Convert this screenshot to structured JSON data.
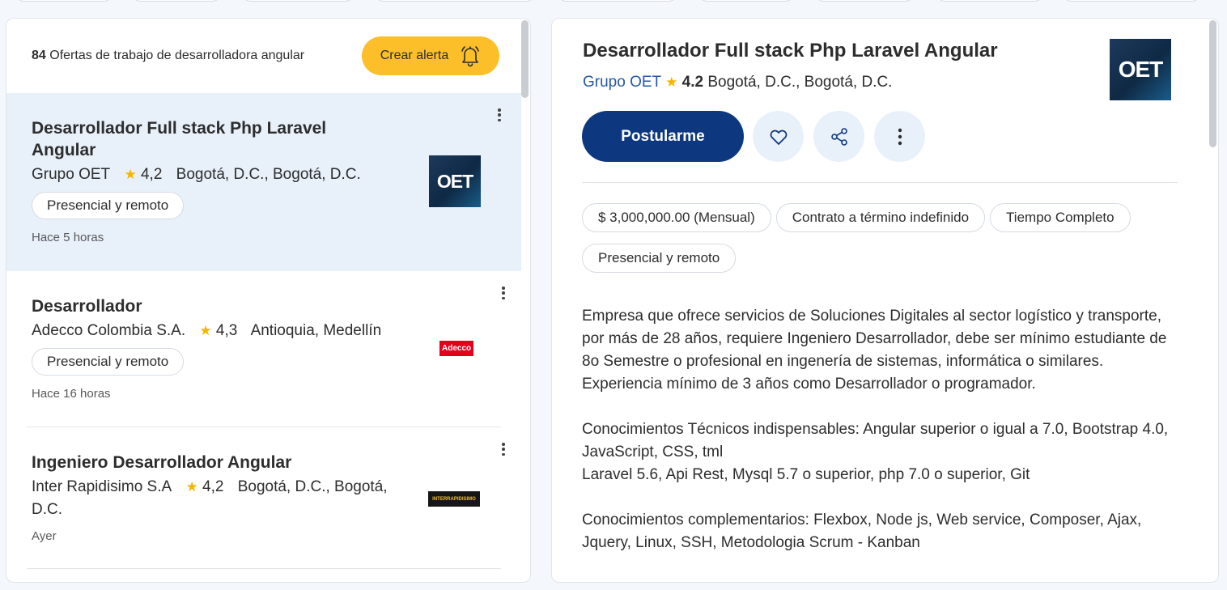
{
  "results": {
    "count": "84",
    "count_text": "Ofertas de trabajo de desarrolladora angular",
    "alert_label": "Crear alerta"
  },
  "jobs": [
    {
      "title": "Desarrollador Full stack Php Laravel Angular",
      "company": "Grupo OET",
      "rating": "4,2",
      "location": "Bogotá, D.C., Bogotá, D.C.",
      "tag": "Presencial y remoto",
      "posted": "Hace 5 horas",
      "logo_text": "OET"
    },
    {
      "title": "Desarrollador",
      "company": "Adecco Colombia S.A.",
      "rating": "4,3",
      "location": "Antioquia, Medellín",
      "tag": "Presencial y remoto",
      "posted": "Hace 16 horas",
      "logo_text": "Adecco"
    },
    {
      "title": "Ingeniero Desarrollador Angular",
      "company": "Inter Rapidisimo S.A",
      "rating": "4,2",
      "location": "Bogotá, D.C., Bogotá, D.C.",
      "posted": "Ayer",
      "logo_text": "INTERRAPIDISIMO"
    }
  ],
  "detail": {
    "title": "Desarrollador Full stack Php Laravel Angular",
    "company": "Grupo OET",
    "rating": "4.2",
    "location": "Bogotá, D.C., Bogotá, D.C.",
    "logo_text": "OET",
    "apply_label": "Postularme",
    "tags": [
      "$ 3,000,000.00 (Mensual)",
      "Contrato a término indefinido",
      "Tiempo Completo",
      "Presencial y remoto"
    ],
    "paragraphs": [
      "Empresa que ofrece servicios de Soluciones Digitales al sector logístico y transporte, por más de 28 años, requiere Ingeniero Desarrollador, debe ser mínimo estudiante de 8o Semestre o profesional en ingenería de sistemas, informática o similares. Experiencia mínimo de 3 años como Desarrollador o programador.",
      "Conocimientos Técnicos indispensables: Angular superior o igual a 7.0, Bootstrap 4.0, JavaScript, CSS, tml\nLaravel 5.6, Api Rest, Mysql 5.7 o superior, php 7.0 o superior, Git",
      "Conocimientos complementarios: Flexbox, Node js, Web service, Composer, Ajax, Jquery, Linux, SSH, Metodologia Scrum - Kanban"
    ]
  },
  "icons": {
    "alert": "bell-icon",
    "save": "heart-icon",
    "share": "share-icon",
    "more": "more-vertical-icon",
    "rating": "star-icon"
  },
  "colors": {
    "accent": "#fcbf2a",
    "primary": "#0d3880",
    "link": "#2557a7",
    "star": "#f5b400",
    "selected_bg": "#e8f0fa"
  }
}
